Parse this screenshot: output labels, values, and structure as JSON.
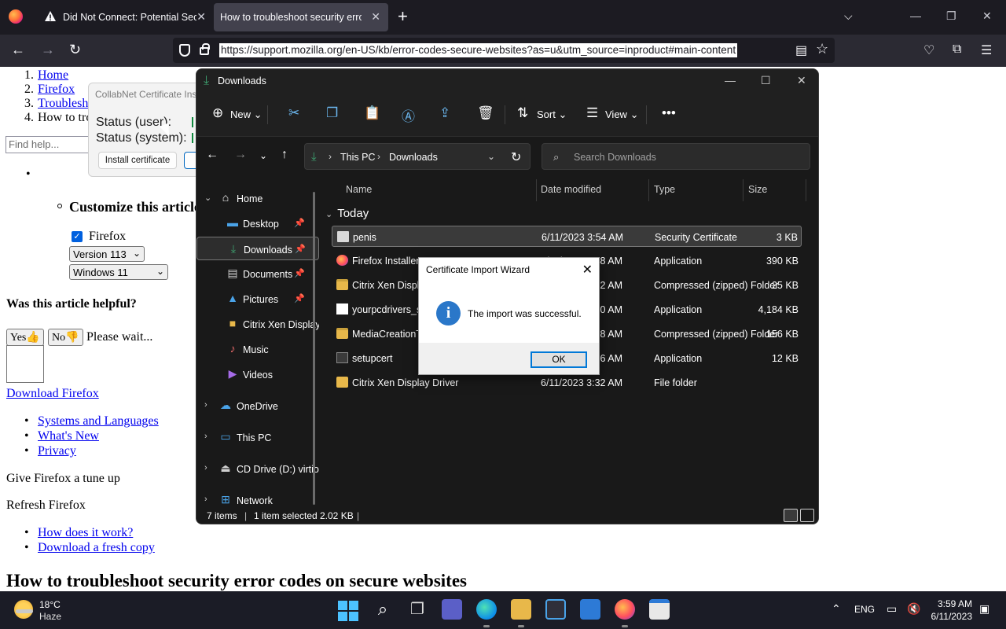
{
  "browser": {
    "tabs": [
      {
        "title": "Did Not Connect: Potential Security Issue"
      },
      {
        "title": "How to troubleshoot security error codes"
      }
    ],
    "url": "https://support.mozilla.org/en-US/kb/error-codes-secure-websites?as=u&utm_source=inproduct#main-content"
  },
  "page": {
    "breadcrumbs": [
      {
        "num": "1.",
        "label": "Home"
      },
      {
        "num": "2.",
        "label": "Firefox"
      },
      {
        "num": "3.",
        "label": "Troubleshoot"
      },
      {
        "num": "4.",
        "label": "How to troubleshoot"
      }
    ],
    "find_placeholder": "Find help...",
    "customize_heading": "Customize this article",
    "product_checkbox": "Firefox",
    "version_select": "Version 113",
    "os_select": "Windows 11",
    "helpful_q": "Was this article helpful?",
    "yes_btn": "Yes👍",
    "no_btn": "No👎",
    "please_wait": "Please wait...",
    "download_link": "Download Firefox",
    "links1": [
      "Systems and Languages",
      "What's New",
      "Privacy"
    ],
    "tune_up": "Give Firefox a tune up",
    "refresh": "Refresh Firefox",
    "links2": [
      "How does it work?",
      "Download a fresh copy"
    ],
    "main_heading": "How to troubleshoot security error codes on secure websites"
  },
  "collabnet": {
    "title": "CollabNet Certificate Installer",
    "status_user": "Status (user):",
    "status_system": "Status (system):",
    "install_btn": "Install certificate"
  },
  "explorer": {
    "title": "Downloads",
    "toolbar": {
      "new": "New",
      "sort": "Sort",
      "view": "View"
    },
    "address": {
      "pc": "This PC",
      "folder": "Downloads"
    },
    "search_placeholder": "Search Downloads",
    "nav": {
      "home": "Home",
      "desktop": "Desktop",
      "downloads": "Downloads",
      "documents": "Documents",
      "pictures": "Pictures",
      "citrix": "Citrix Xen Display Driver",
      "music": "Music",
      "videos": "Videos",
      "onedrive": "OneDrive",
      "thispc": "This PC",
      "cddrive": "CD Drive (D:) virtio-win",
      "network": "Network"
    },
    "columns": {
      "name": "Name",
      "date": "Date modified",
      "type": "Type",
      "size": "Size"
    },
    "group": "Today",
    "files": [
      {
        "name": "penis",
        "date": "6/11/2023 3:54 AM",
        "type": "Security Certificate",
        "size": "3 KB",
        "icon": "certificate-icon"
      },
      {
        "name": "Firefox Installer",
        "date": "6/11/2023 3:48 AM",
        "type": "Application",
        "size": "390 KB",
        "icon": "firefox-icon"
      },
      {
        "name": "Citrix Xen Display Driver",
        "date": "6/11/2023 3:32 AM",
        "type": "Compressed (zipped) Folder",
        "size": "25 KB",
        "icon": "zip-icon"
      },
      {
        "name": "yourpcdrivers_setup",
        "date": "6/11/2023 3:30 AM",
        "type": "Application",
        "size": "4,184 KB",
        "icon": "app-icon"
      },
      {
        "name": "MediaCreationTool",
        "date": "6/11/2023 3:28 AM",
        "type": "Compressed (zipped) Folder",
        "size": "156 KB",
        "icon": "zip-icon"
      },
      {
        "name": "setupcert",
        "date": "6/11/2023 3:26 AM",
        "type": "Application",
        "size": "12 KB",
        "icon": "app-icon"
      },
      {
        "name": "Citrix Xen Display Driver",
        "date": "6/11/2023 3:32 AM",
        "type": "File folder",
        "size": "",
        "icon": "folder-icon"
      }
    ],
    "status": {
      "items": "7 items",
      "selected": "1 item selected",
      "size": "2.02 KB"
    }
  },
  "wizard": {
    "title": "Certificate Import Wizard",
    "message": "The import was successful.",
    "ok": "OK"
  },
  "taskbar": {
    "temp": "18°C",
    "condition": "Haze",
    "lang": "ENG",
    "time": "3:59 AM",
    "date": "6/11/2023"
  }
}
